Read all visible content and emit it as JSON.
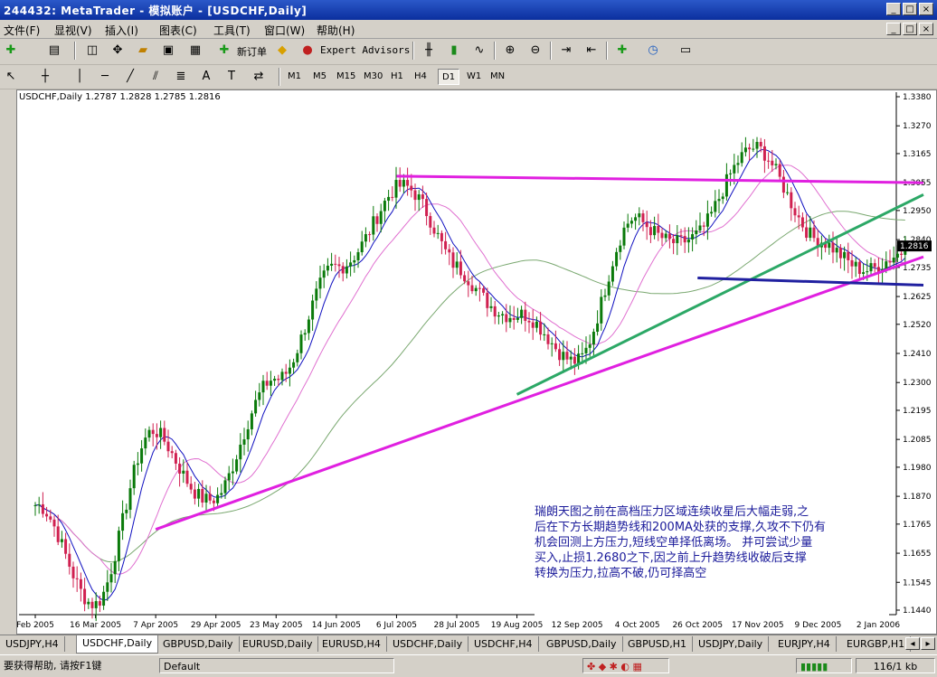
{
  "window": {
    "title": "244432: MetaTrader - 模拟账户 - [USDCHF,Daily]",
    "controls": [
      "_",
      "□",
      "×"
    ]
  },
  "menu": {
    "items": [
      "文件(F)",
      "显视(V)",
      "插入(I)",
      "图表(C)",
      "工具(T)",
      "窗口(W)",
      "帮助(H)"
    ]
  },
  "toolbar": {
    "new_order_label": "新订单",
    "expert_advisors_label": "Expert Advisors"
  },
  "timeframes": [
    "M1",
    "M5",
    "M15",
    "M30",
    "H1",
    "H4",
    "D1",
    "W1",
    "MN"
  ],
  "active_timeframe": "D1",
  "chart": {
    "info": "USDCHF,Daily  1.2787 1.2828 1.2785 1.2816",
    "current_price_label": "1.2816",
    "annotation_lines": [
      "瑞朗天图之前在高档压力区域连续收星后大幅走弱,之",
      "后在下方长期趋势线和200MA处获的支撑,久攻不下仍有",
      "机会回测上方压力,短线空单择低离场。 并可尝试少量",
      "买入,止损1.2680之下,因之前上升趋势线收破后支撑",
      "转换为压力,拉高不破,仍可择高空"
    ]
  },
  "chart_data": {
    "type": "candlestick",
    "symbol": "USDCHF",
    "timeframe": "Daily",
    "y_ticks": [
      1.338,
      1.327,
      1.3165,
      1.3055,
      1.295,
      1.284,
      1.2735,
      1.2625,
      1.252,
      1.241,
      1.23,
      1.2195,
      1.2085,
      1.198,
      1.187,
      1.1765,
      1.1655,
      1.1545,
      1.144
    ],
    "x_ticks": [
      "Feb 2005",
      "16 Mar 2005",
      "7 Apr 2005",
      "29 Apr 2005",
      "23 May 2005",
      "14 Jun 2005",
      "6 Jul 2005",
      "28 Jul 2005",
      "19 Aug 2005",
      "12 Sep 2005",
      "4 Oct 2005",
      "26 Oct 2005",
      "17 Nov 2005",
      "9 Dec 2005",
      "2 Jan 2006"
    ],
    "ylim": [
      1.144,
      1.338
    ],
    "last": {
      "open": 1.2787,
      "high": 1.2828,
      "low": 1.2785,
      "close": 1.2816
    },
    "key_closes": [
      {
        "x": "Feb 2005",
        "y": 1.18
      },
      {
        "x": "16 Mar 2005",
        "y": 1.15
      },
      {
        "x": "7 Apr 2005",
        "y": 1.21
      },
      {
        "x": "29 Apr 2005",
        "y": 1.185
      },
      {
        "x": "23 May 2005",
        "y": 1.235
      },
      {
        "x": "14 Jun 2005",
        "y": 1.27
      },
      {
        "x": "6 Jul 2005",
        "y": 1.3055
      },
      {
        "x": "28 Jul 2005",
        "y": 1.275
      },
      {
        "x": "19 Aug 2005",
        "y": 1.252
      },
      {
        "x": "12 Sep 2005",
        "y": 1.242
      },
      {
        "x": "4 Oct 2005",
        "y": 1.29
      },
      {
        "x": "26 Oct 2005",
        "y": 1.285
      },
      {
        "x": "17 Nov 2005",
        "y": 1.322
      },
      {
        "x": "9 Dec 2005",
        "y": 1.28
      },
      {
        "x": "2 Jan 2006",
        "y": 1.276
      }
    ],
    "trendlines": [
      {
        "color": "#e020e0",
        "from": {
          "x": "7 Apr 2005",
          "y": 1.1745
        },
        "to": {
          "x": "2 Jan 2006",
          "y": 1.2775
        }
      },
      {
        "color": "#e020e0",
        "from": {
          "x": "6 Jul 2005",
          "y": 1.308
        },
        "to": {
          "x": "2 Jan 2006",
          "y": 1.3055
        }
      },
      {
        "color": "#2ca866",
        "from": {
          "x": "19 Aug 2005",
          "y": 1.2255
        },
        "to": {
          "x": "2 Jan 2006",
          "y": 1.301
        }
      },
      {
        "color": "#2020a0",
        "from": {
          "x": "26 Oct 2005",
          "y": 1.2695
        },
        "to": {
          "x": "2 Jan 2006",
          "y": 1.2668
        }
      }
    ],
    "colors": {
      "bull": "#0a7a0a",
      "bear": "#d02050",
      "ma_fast": "#1010c0",
      "ma_mid": "#e070d0",
      "ma_slow": "#7aa870"
    }
  },
  "tabs": [
    "USDJPY,H4",
    "USDCHF,Daily",
    "GBPUSD,Daily",
    "EURUSD,Daily",
    "EURUSD,H4",
    "USDCHF,Daily",
    "USDCHF,H4",
    "GBPUSD,Daily",
    "GBPUSD,H1",
    "USDJPY,Daily",
    "EURJPY,H4",
    "EURGBP,H1"
  ],
  "active_tab": 1,
  "status": {
    "help": "要获得帮助, 请按F1键",
    "profile": "Default",
    "traffic": "116/1 kb"
  }
}
